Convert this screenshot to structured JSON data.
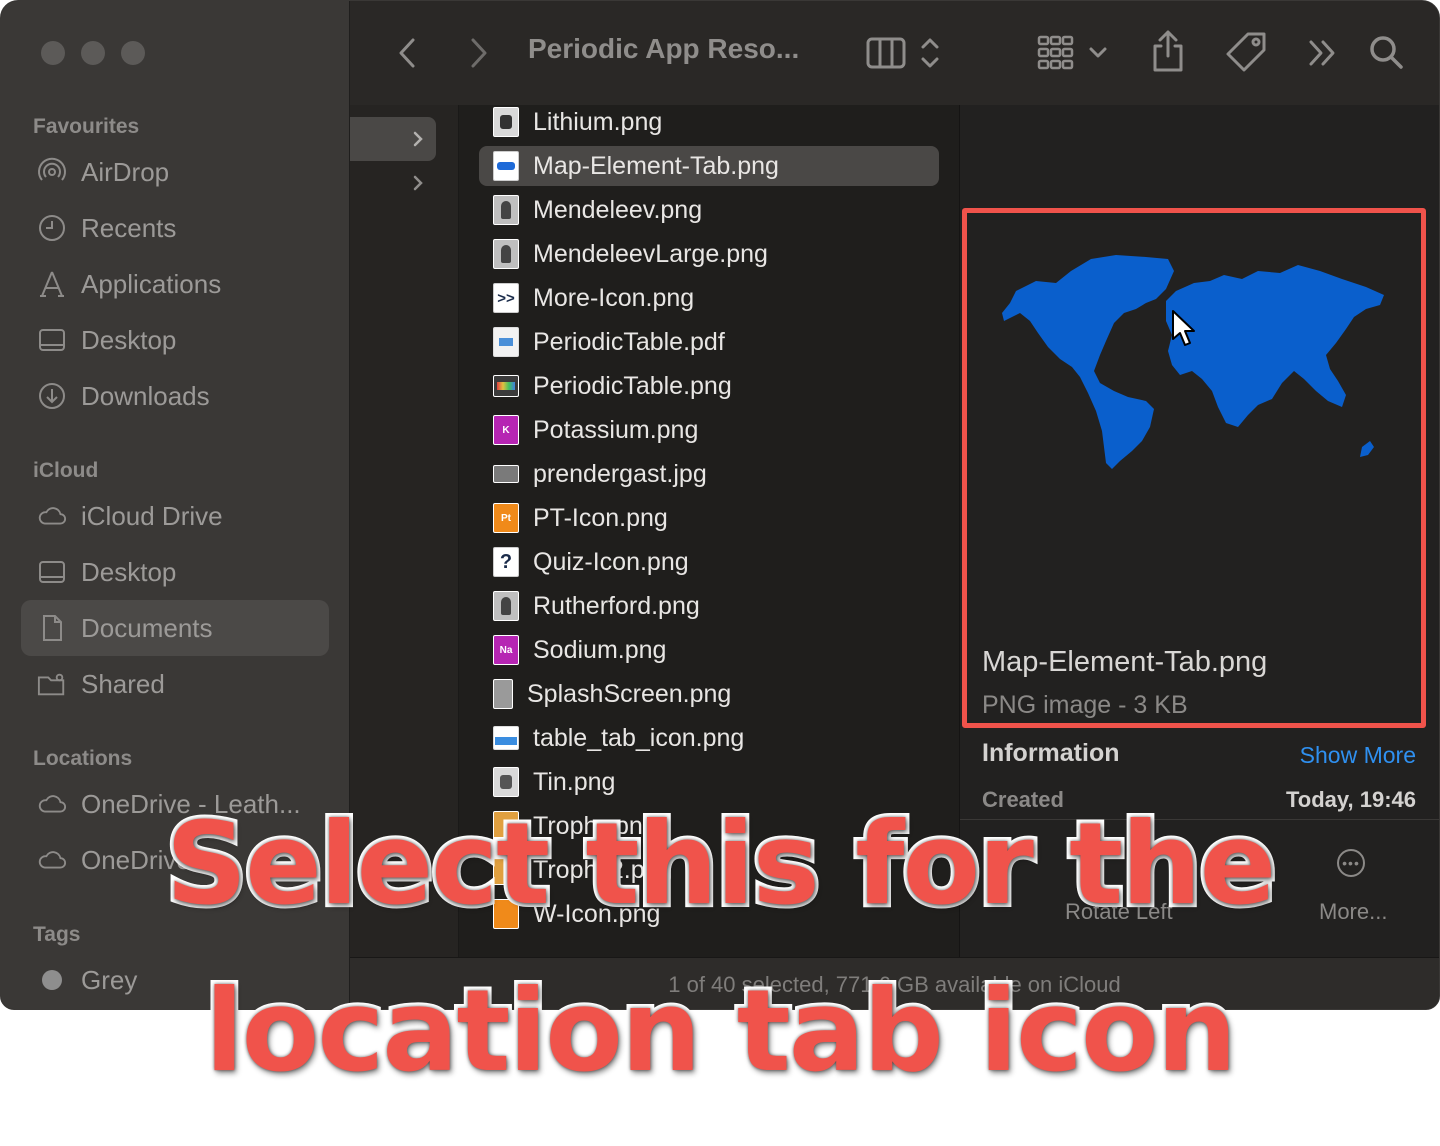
{
  "window": {
    "title": "Periodic App Reso...",
    "status": "1 of 40 selected, 771.6 GB available on iCloud"
  },
  "sidebar": {
    "favourites_label": "Favourites",
    "favourites": [
      {
        "label": "AirDrop",
        "icon": "airdrop-icon"
      },
      {
        "label": "Recents",
        "icon": "clock-icon"
      },
      {
        "label": "Applications",
        "icon": "applications-icon"
      },
      {
        "label": "Desktop",
        "icon": "desktop-icon"
      },
      {
        "label": "Downloads",
        "icon": "download-icon"
      }
    ],
    "icloud_label": "iCloud",
    "icloud": [
      {
        "label": "iCloud Drive",
        "icon": "cloud-icon"
      },
      {
        "label": "Desktop",
        "icon": "desktop-icon"
      },
      {
        "label": "Documents",
        "icon": "document-icon",
        "selected": true
      },
      {
        "label": "Shared",
        "icon": "shared-folder-icon"
      }
    ],
    "locations_label": "Locations",
    "locations": [
      {
        "label": "OneDrive - Leath...",
        "icon": "cloud-icon"
      },
      {
        "label": "OneDrive",
        "icon": "cloud-icon"
      }
    ],
    "tags_label": "Tags",
    "tags": [
      {
        "label": "Grey",
        "color": "#8e8e8e"
      }
    ]
  },
  "files": [
    {
      "name": "Lithium.png",
      "icon": "image-thumb-icon",
      "thumb_color": "#d9d9d9"
    },
    {
      "name": "Map-Element-Tab.png",
      "icon": "map-thumb-icon",
      "thumb_color": "#1e6ad8",
      "selected": true
    },
    {
      "name": "Mendeleev.png",
      "icon": "portrait-thumb-icon",
      "thumb_color": "#bfbfbf"
    },
    {
      "name": "MendeleevLarge.png",
      "icon": "portrait-thumb-icon",
      "thumb_color": "#bfbfbf"
    },
    {
      "name": "More-Icon.png",
      "icon": "more-thumb-icon",
      "thumb_color": "#1a2b4a",
      "glyph": ">>"
    },
    {
      "name": "PeriodicTable.pdf",
      "icon": "pdf-thumb-icon",
      "thumb_color": "#f2f2f2"
    },
    {
      "name": "PeriodicTable.png",
      "icon": "table-thumb-icon",
      "thumb_color": "#3b3b3b"
    },
    {
      "name": "Potassium.png",
      "icon": "element-thumb-icon",
      "thumb_color": "#b625b3",
      "glyph": "K"
    },
    {
      "name": "prendergast.jpg",
      "icon": "photo-thumb-icon",
      "thumb_color": "#7a7a7a"
    },
    {
      "name": "PT-Icon.png",
      "icon": "element-thumb-icon",
      "thumb_color": "#f08a1a",
      "glyph": "Pt"
    },
    {
      "name": "Quiz-Icon.png",
      "icon": "quiz-thumb-icon",
      "thumb_color": "#ffffff",
      "glyph": "?"
    },
    {
      "name": "Rutherford.png",
      "icon": "portrait-thumb-icon",
      "thumb_color": "#bfbfbf"
    },
    {
      "name": "Sodium.png",
      "icon": "element-thumb-icon",
      "thumb_color": "#b625b3",
      "glyph": "Na"
    },
    {
      "name": "SplashScreen.png",
      "icon": "splash-thumb-icon",
      "thumb_color": "#9a9a9a"
    },
    {
      "name": "table_tab_icon.png",
      "icon": "tab-thumb-icon",
      "thumb_color": "#3a8de0"
    },
    {
      "name": "Tin.png",
      "icon": "image-thumb-icon",
      "thumb_color": "#d9d9d9"
    },
    {
      "name": "Trophy.png",
      "icon": "trophy-thumb-icon",
      "thumb_color": "#e0a040"
    },
    {
      "name": "Trophy2.png",
      "icon": "trophy-thumb-icon",
      "thumb_color": "#e0a040"
    },
    {
      "name": "W-Icon.png",
      "icon": "element-thumb-icon",
      "thumb_color": "#f08a1a"
    }
  ],
  "preview": {
    "name": "Map-Element-Tab.png",
    "meta": "PNG image - 3 KB",
    "info_label": "Information",
    "show_more": "Show More",
    "created_label": "Created",
    "created_value": "Today, 19:46",
    "rotate_label": "Rotate Left",
    "more_label": "More..."
  },
  "overlay": {
    "line1": "Select this for the",
    "line2": "location tab icon",
    "color": "#f0534b"
  }
}
